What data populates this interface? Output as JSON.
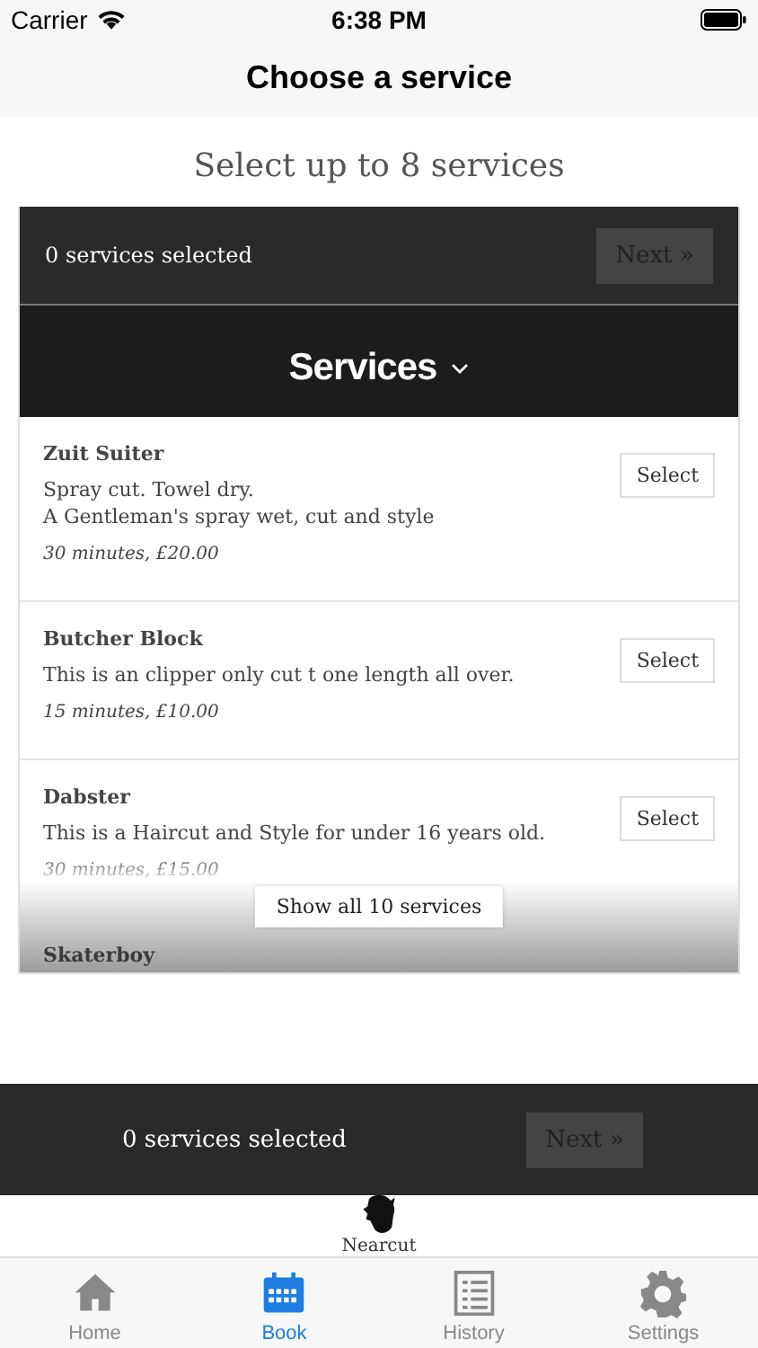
{
  "status_bar": {
    "carrier": "Carrier",
    "time": "6:38 PM"
  },
  "nav": {
    "title": "Choose a service"
  },
  "heading": "Select up to 8 services",
  "summary": {
    "text": "0 services selected",
    "next": {
      "label": "Next »",
      "disabled": true
    }
  },
  "section": {
    "title": "Services"
  },
  "services": [
    {
      "name": "Zuit Suiter",
      "description": [
        "Spray cut. Towel dry.",
        "A Gentleman's spray wet, cut and style"
      ],
      "meta": "30 minutes, £20.00",
      "button": "Select"
    },
    {
      "name": "Butcher Block",
      "description": [
        "This is an clipper only cut t one length all over."
      ],
      "meta": "15 minutes, £10.00",
      "button": "Select"
    },
    {
      "name": "Dabster",
      "description": [
        "This is a Haircut and Style for under 16 years old."
      ],
      "meta": "30 minutes, £15.00",
      "button": "Select"
    },
    {
      "name": "Skaterboy"
    }
  ],
  "show_all": "Show all 10 services",
  "footer_bar": {
    "text": "0 services selected",
    "next": {
      "label": "Next »",
      "disabled": true
    }
  },
  "brand": "Nearcut",
  "tabs": [
    {
      "label": "Home",
      "kind": "home",
      "selected": false
    },
    {
      "label": "Book",
      "kind": "calendar",
      "selected": true
    },
    {
      "label": "History",
      "kind": "list",
      "selected": false
    },
    {
      "label": "Settings",
      "kind": "gear",
      "selected": false
    }
  ]
}
